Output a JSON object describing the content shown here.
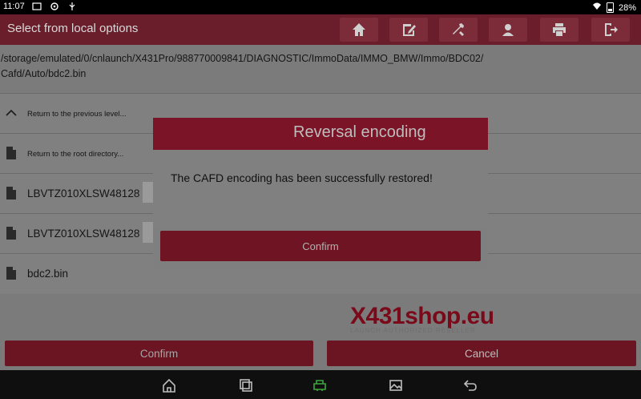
{
  "status_bar": {
    "time": "11:07",
    "battery": "28%"
  },
  "titlebar": {
    "title": "Select from local options",
    "toolbar_icons": [
      "home-icon",
      "edit-report-icon",
      "tools-icon",
      "user-icon",
      "print-icon",
      "exit-icon"
    ]
  },
  "file_path": "/storage/emulated/0/cnlaunch/X431Pro/988770009841/DIAGNOSTIC/ImmoData/IMMO_BMW/Immo/BDC02/ Cafd/Auto/bdc2.bin",
  "rows": [
    {
      "label": "Return to the previous level...",
      "icon": "chevron-up-icon"
    },
    {
      "label": "Return to the root directory...",
      "icon": "file-icon"
    },
    {
      "label": "LBVTZ010XLSW48128",
      "icon": "file-icon"
    },
    {
      "label": "LBVTZ010XLSW48128",
      "icon": "file-icon"
    },
    {
      "label": "bdc2.bin",
      "icon": "file-icon"
    }
  ],
  "dialog": {
    "title": "Reversal encoding",
    "message": "The CAFD encoding has been successfully restored!",
    "confirm_label": "Confirm"
  },
  "watermark": {
    "text": "X431shop.eu",
    "subtitle": "LAUNCH AUTHORIZED RESELLER"
  },
  "bottom_buttons": {
    "confirm_label": "Confirm",
    "cancel_label": "Cancel"
  },
  "colors": {
    "brand": "#7a1426",
    "button_dim": "#6a1521",
    "overlay_bg": "#7b7b7b"
  }
}
